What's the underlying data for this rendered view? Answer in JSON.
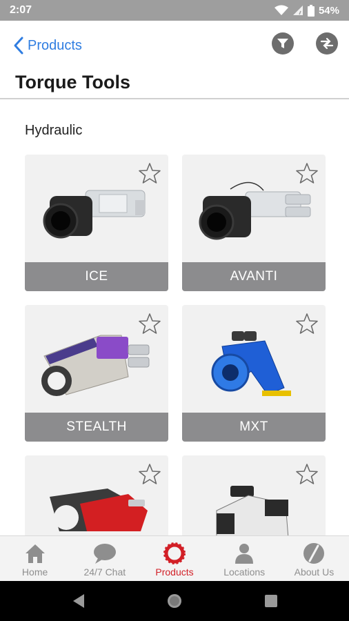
{
  "status_bar": {
    "time": "2:07",
    "battery": "54%"
  },
  "header": {
    "back_label": "Products",
    "title": "Torque Tools"
  },
  "section": {
    "title": "Hydraulic"
  },
  "products": [
    {
      "name": "ICE"
    },
    {
      "name": "AVANTI"
    },
    {
      "name": "STEALTH"
    },
    {
      "name": "MXT"
    },
    {
      "name": ""
    },
    {
      "name": ""
    }
  ],
  "nav": {
    "items": [
      {
        "label": "Home",
        "icon": "home-icon"
      },
      {
        "label": "24/7 Chat",
        "icon": "chat-icon"
      },
      {
        "label": "Products",
        "icon": "products-ring-icon"
      },
      {
        "label": "Locations",
        "icon": "person-icon"
      },
      {
        "label": "About Us",
        "icon": "about-icon"
      }
    ],
    "active": "Products"
  },
  "colors": {
    "accent_blue": "#2f7de1",
    "active_red": "#d21f26",
    "label_gray": "#8c8c8e",
    "status_gray": "#9e9e9e"
  }
}
